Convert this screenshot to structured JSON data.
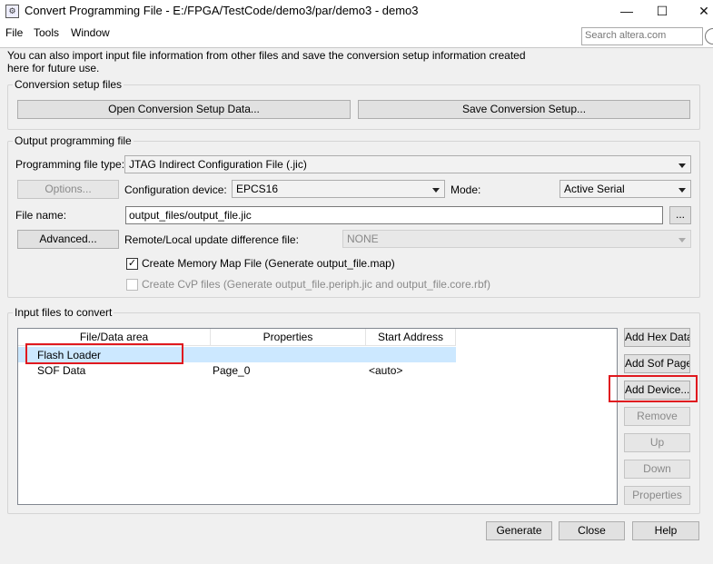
{
  "window": {
    "title": "Convert Programming File - E:/FPGA/TestCode/demo3/par/demo3 - demo3",
    "app_icon_glyph": "⚙",
    "minimize_glyph": "—",
    "maximize_glyph": "☐",
    "close_glyph": "✕"
  },
  "menu": {
    "items": [
      "File",
      "Tools",
      "Window"
    ],
    "search_placeholder": "Search altera.com"
  },
  "intro": "You can also import input file information from other files and save the conversion setup information created here for future use.",
  "setup_files": {
    "label": "Conversion setup files",
    "open_button": "Open Conversion Setup Data...",
    "save_button": "Save Conversion Setup..."
  },
  "output": {
    "label": "Output programming file",
    "file_type_label": "Programming file type:",
    "file_type_value": "JTAG Indirect Configuration File (.jic)",
    "options_button": "Options...",
    "config_device_label": "Configuration device:",
    "config_device_value": "EPCS16",
    "mode_label": "Mode:",
    "mode_value": "Active Serial",
    "file_name_label": "File name:",
    "file_name_value": "output_files/output_file.jic",
    "browse_button": "...",
    "advanced_button": "Advanced...",
    "update_diff_label": "Remote/Local update difference file:",
    "update_diff_value": "NONE",
    "memory_map_label": "Create Memory Map File (Generate output_file.map)",
    "memory_map_checked": true,
    "cvp_label": "Create CvP files (Generate output_file.periph.jic and output_file.core.rbf)",
    "cvp_checked": false
  },
  "input": {
    "label": "Input files to convert",
    "columns": [
      "File/Data area",
      "Properties",
      "Start Address"
    ],
    "rows": [
      {
        "name": "Flash Loader",
        "properties": "",
        "start": ""
      },
      {
        "name": "SOF Data",
        "properties": "Page_0",
        "start": "<auto>"
      }
    ],
    "selected_row": 0,
    "buttons": {
      "add_hex": "Add Hex Data",
      "add_sof": "Add Sof Page",
      "add_device": "Add Device...",
      "remove": "Remove",
      "up": "Up",
      "down": "Down",
      "properties": "Properties"
    }
  },
  "footer": {
    "generate": "Generate",
    "close": "Close",
    "help": "Help"
  },
  "colors": {
    "selection": "#cce8ff",
    "highlight_box": "#e0191f"
  }
}
